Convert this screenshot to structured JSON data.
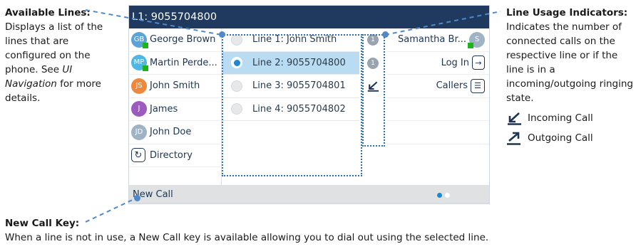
{
  "annotations": {
    "available_lines": {
      "heading": "Available Lines:",
      "body_pre": "Displays a list of the lines that are configured on the phone. See ",
      "body_link": "UI Navigation",
      "body_post": " for more details."
    },
    "line_usage": {
      "heading": "Line Usage Indicators:",
      "body": "Indicates the number of connected calls on the respective line or if the line is in a incoming/outgoing ringing state.",
      "incoming_label": "Incoming Call",
      "outgoing_label": "Outgoing Call"
    },
    "new_call_key": {
      "heading": "New Call Key:",
      "body": "When a line is not in use, a New Call key is available allowing you to dial out using the selected line."
    }
  },
  "phone": {
    "title": "L1: 9055704800",
    "contacts": [
      {
        "initials": "GB",
        "name": "George Brown",
        "color": "#5aa2d8",
        "presence": true
      },
      {
        "initials": "MP",
        "name": "Martin Perde...",
        "color": "#4fb7e6",
        "presence": true
      },
      {
        "initials": "JS",
        "name": "John Smith",
        "color": "#f0883c",
        "presence": false
      },
      {
        "initials": "J",
        "name": "James",
        "color": "#9b5bbf",
        "presence": false
      },
      {
        "initials": "JD",
        "name": "John Doe",
        "color": "#9fb3c4",
        "presence": false
      }
    ],
    "directory_label": "Directory",
    "lines": [
      {
        "label": "Line 1: John Smith",
        "selected": false
      },
      {
        "label": "Line 2: 9055704800",
        "selected": true
      },
      {
        "label": "Line 3: 9055704801",
        "selected": false
      },
      {
        "label": "Line 4: 9055704802",
        "selected": false
      }
    ],
    "indicators": [
      "1",
      "1"
    ],
    "softkeys": {
      "user_name": "Samantha Br...",
      "user_initial": "S",
      "login_label": "Log In",
      "callers_label": "Callers"
    },
    "new_call_label": "New Call",
    "page_dots": {
      "active": "#1e87d4",
      "inactive": "#ffffff"
    }
  },
  "colors": {
    "title_bar": "#1f3a5e",
    "selected_line": "#b9dcf2",
    "callout": "#2f6fb5",
    "presence": "#1db31d"
  }
}
